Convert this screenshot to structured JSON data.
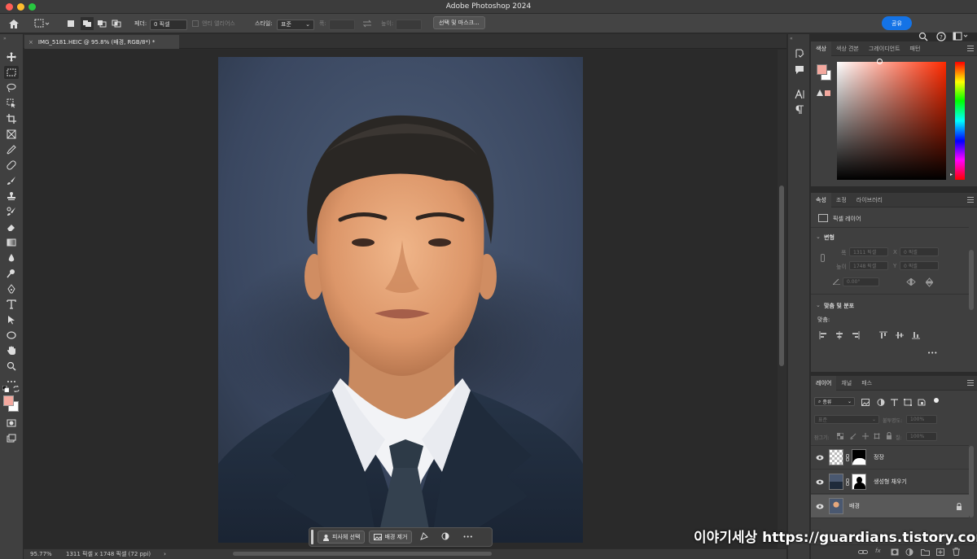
{
  "app": {
    "title": "Adobe Photoshop 2024"
  },
  "options_bar": {
    "feather_label": "페더:",
    "feather_value": "0 픽셀",
    "antialias_label": "앤티 앨리어스",
    "style_label": "스타일:",
    "style_value": "표준",
    "width_label": "폭:",
    "height_label": "높이:",
    "select_mask_label": "선택 및 마스크...",
    "share_label": "공유"
  },
  "document": {
    "tab_label": "IMG_5181.HEIC @ 95.8% (배경, RGB/8*) *",
    "close_glyph": "×"
  },
  "context_bar": {
    "select_subject": "피사체 선택",
    "remove_bg": "배경 제거",
    "more": "•••"
  },
  "status_bar": {
    "zoom": "95.77%",
    "doc_info": "1311 픽셀 x 1748 픽셀 (72 ppi)",
    "chevron": "›"
  },
  "color_panel": {
    "tabs": [
      "색상",
      "색상 견본",
      "그레이디언트",
      "패턴"
    ],
    "fg_color": "#f4a99f",
    "bg_color": "#ffffff",
    "hue_color": "#ff2a00"
  },
  "properties_panel": {
    "tabs": [
      "속성",
      "조정",
      "라이브러리"
    ],
    "layer_type": "픽셀 레이어",
    "transform_title": "변형",
    "w_label": "폭",
    "w_value": "1311 픽셀",
    "x_label": "X",
    "x_value": "0 픽셀",
    "h_label": "높이",
    "h_value": "1748 픽셀",
    "y_label": "Y",
    "y_value": "0 픽셀",
    "angle_value": "0.00°",
    "align_title": "맞춤 및 분포",
    "align_label": "맞춤:",
    "more": "•••"
  },
  "layers_panel": {
    "tabs": [
      "레이어",
      "채널",
      "패스"
    ],
    "filter_label": "종류",
    "blend_mode": "표준",
    "opacity_label": "불투명도:",
    "opacity_value": "100%",
    "lock_label": "잠그기:",
    "fill_label": "칠:",
    "fill_value": "100%",
    "layers": [
      {
        "name": "정장"
      },
      {
        "name": "생성형 채우기"
      },
      {
        "name": "배경"
      }
    ]
  },
  "watermark": "이야기세상 https://guardians.tistory.com",
  "icons": {
    "toolbar": [
      "move-icon",
      "marquee-icon",
      "lasso-icon",
      "object-select-icon",
      "crop-icon",
      "frame-icon",
      "eyedropper-icon",
      "healing-icon",
      "brush-icon",
      "stamp-icon",
      "history-brush-icon",
      "eraser-icon",
      "gradient-icon",
      "blur-icon",
      "dodge-icon",
      "pen-icon",
      "type-icon",
      "path-select-icon",
      "shape-icon",
      "hand-icon",
      "zoom-icon",
      "more-tools-icon"
    ]
  }
}
